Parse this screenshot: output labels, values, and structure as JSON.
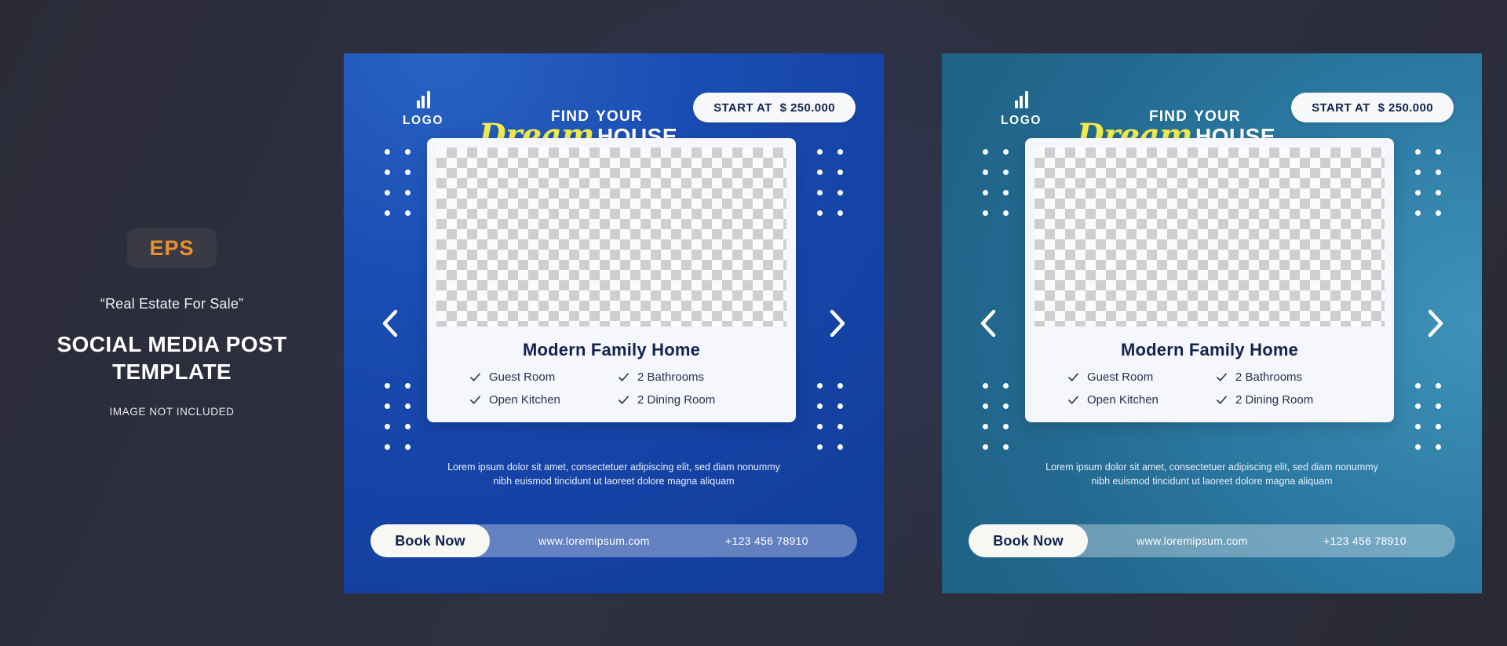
{
  "info": {
    "badge": "EPS",
    "quote": "“Real Estate For Sale”",
    "title_line1": "SOCIAL MEDIA POST",
    "title_line2": "TEMPLATE",
    "note": "IMAGE NOT INCLUDED"
  },
  "colors": {
    "background": "#2b2b38",
    "badge_bg": "#3a3a46",
    "badge_text": "#e8912b",
    "card_blue": "#1a4eb4",
    "card_teal": "#2d7ba4",
    "script_yellow": "#f2ec4c",
    "panel_bg": "#f5f7fc",
    "heading_navy": "#13234d"
  },
  "card": {
    "logo_text": "LOGO",
    "logo_icon": "bar-chart-icon",
    "brand_line1_a": "FIND",
    "brand_line1_b": "YOUR",
    "brand_script": "Dream",
    "brand_house": "HOUSE",
    "price_label": "START AT",
    "price_value": "$ 250.000",
    "property_title": "Modern Family Home",
    "features": [
      "Guest Room",
      "2 Bathrooms",
      "Open Kitchen",
      "2 Dining Room"
    ],
    "blurb_line1": "Lorem ipsum dolor sit amet, consectetuer adipiscing elit, sed diam nonummy",
    "blurb_line2": "nibh euismod tincidunt ut laoreet dolore magna aliquam",
    "book_label": "Book Now",
    "website": "www.loremipsum.com",
    "phone": "+123 456 78910",
    "prev_icon": "chevron-left-icon",
    "next_icon": "chevron-right-icon",
    "photo_placeholder": "transparent-checker-placeholder"
  }
}
